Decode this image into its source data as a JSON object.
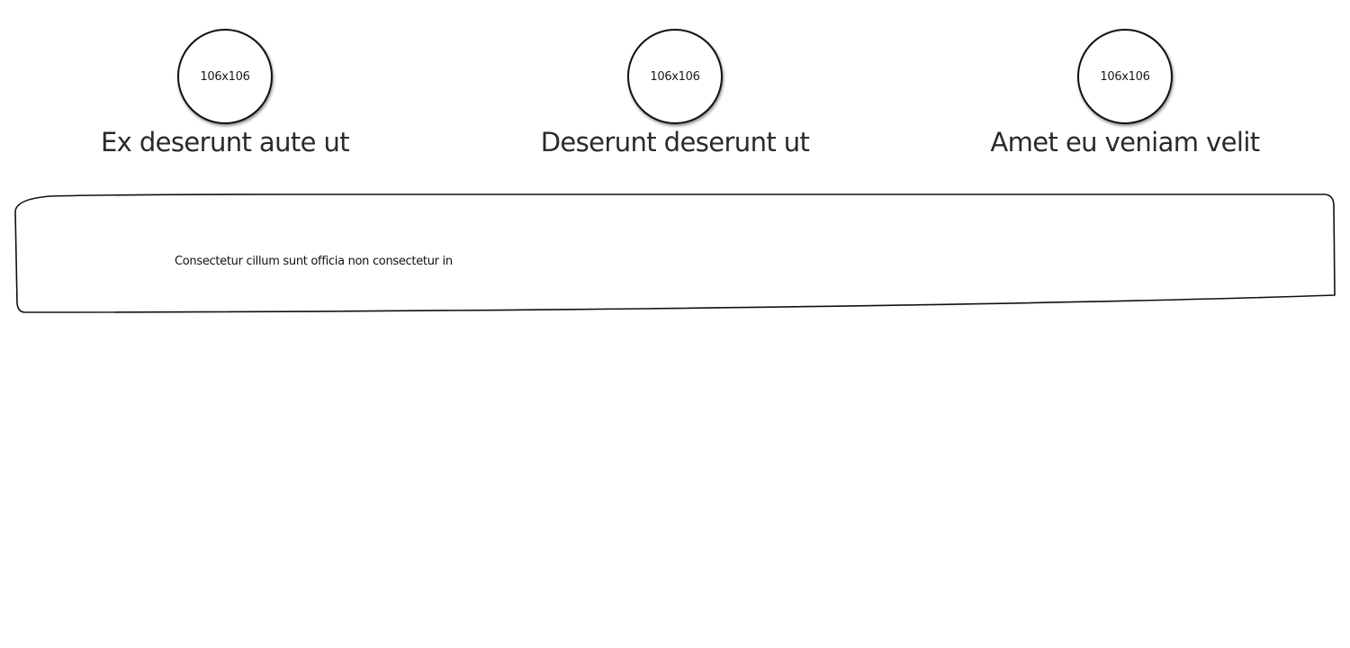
{
  "cards": [
    {
      "image_placeholder": "106x106",
      "title": "Ex deserunt aute ut"
    },
    {
      "image_placeholder": "106x106",
      "title": "Deserunt deserunt ut"
    },
    {
      "image_placeholder": "106x106",
      "title": "Amet eu veniam velit"
    }
  ],
  "panel": {
    "text": "Consectetur cillum sunt officia non consectetur in"
  },
  "colors": {
    "background": "#ffffff",
    "stroke": "#111111",
    "text": "#2a2a2a"
  }
}
